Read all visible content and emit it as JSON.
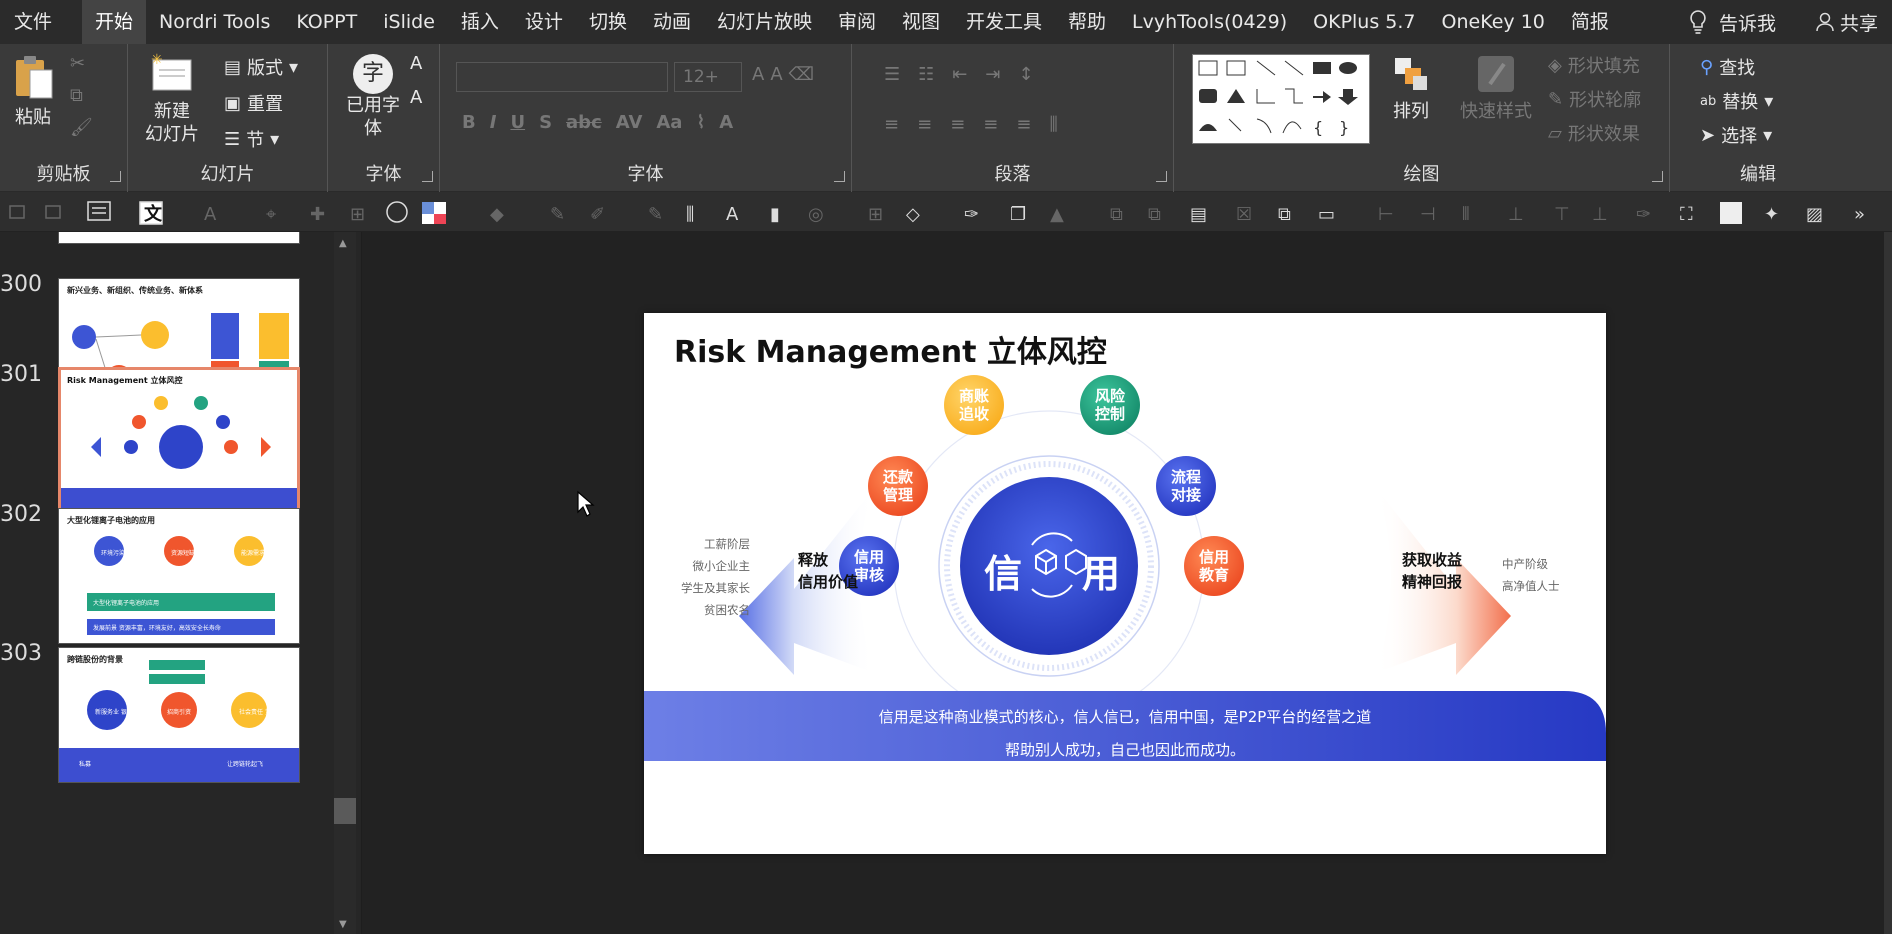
{
  "tabs": [
    "文件",
    "开始",
    "Nordri Tools",
    "KOPPT",
    "iSlide",
    "插入",
    "设计",
    "切换",
    "动画",
    "幻灯片放映",
    "审阅",
    "视图",
    "开发工具",
    "帮助",
    "LvyhTools(0429)",
    "OKPlus 5.7",
    "OneKey 10",
    "简报"
  ],
  "active_tab": "开始",
  "tell_me": "告诉我",
  "share": "共享",
  "ribbon": {
    "clipboard": {
      "label": "剪贴板",
      "paste": "粘贴"
    },
    "slides": {
      "label": "幻灯片",
      "new_slide": [
        "新建",
        "幻灯片"
      ],
      "layout": "版式",
      "reset": "重置",
      "section": "节"
    },
    "font_custom": {
      "label": "字体",
      "btn": [
        "已用字",
        "体"
      ],
      "glyph": "字"
    },
    "font": {
      "label": "字体",
      "size": "12+"
    },
    "paragraph": {
      "label": "段落"
    },
    "drawing": {
      "label": "绘图",
      "arrange": "排列",
      "quick_styles": "快速样式",
      "fill": "形状填充",
      "outline": "形状轮廓",
      "effect": "形状效果"
    },
    "editing": {
      "label": "编辑",
      "find": "查找",
      "replace": "替换",
      "select": "选择"
    }
  },
  "thumbnails": [
    {
      "num": "300",
      "title": "新兴业务、新组织、传统业务、新体系"
    },
    {
      "num": "301",
      "title": "Risk Management 立体风控"
    },
    {
      "num": "302",
      "title": "大型化锂离子电池的应用"
    },
    {
      "num": "303",
      "title": "跨链股份的背景"
    }
  ],
  "thumb_texts": {
    "t302": [
      "环境污染",
      "资源短缺",
      "能源需求",
      "大型化锂离子电池的应用",
      "发展前景 资源丰富，环境友好，高效安全长寿命"
    ],
    "t303": [
      "新服务业 银行贷款",
      "招商引资",
      "社会责任 贷款",
      "私募",
      "让跨链轮起飞"
    ]
  },
  "slide": {
    "title": "Risk Management 立体风控",
    "center_left": "信",
    "center_right": "用",
    "nodes": [
      {
        "text": [
          "商账",
          "追收"
        ],
        "color": "yellow"
      },
      {
        "text": [
          "风险",
          "控制"
        ],
        "color": "green"
      },
      {
        "text": [
          "还款",
          "管理"
        ],
        "color": "orange"
      },
      {
        "text": [
          "流程",
          "对接"
        ],
        "color": "blue"
      },
      {
        "text": [
          "信用",
          "审核"
        ],
        "color": "blue"
      },
      {
        "text": [
          "信用",
          "教育"
        ],
        "color": "orange"
      }
    ],
    "left_arrow_text": [
      "释放",
      "信用价值"
    ],
    "right_arrow_text": [
      "获取收益",
      "精神回报"
    ],
    "left_list": [
      "工薪阶层",
      "微小企业主",
      "学生及其家长",
      "贫困农名"
    ],
    "right_list": [
      "中产阶级",
      "高净值人士"
    ],
    "footer": [
      "信用是这种商业模式的核心，信人信已，信用中国，是P2P平台的经营之道",
      "帮助别人成功，自己也因此而成功。"
    ]
  },
  "colors": {
    "blue": "#2e44c9",
    "orange": "#f0562d",
    "yellow": "#fbbe2e",
    "green": "#23a381"
  }
}
